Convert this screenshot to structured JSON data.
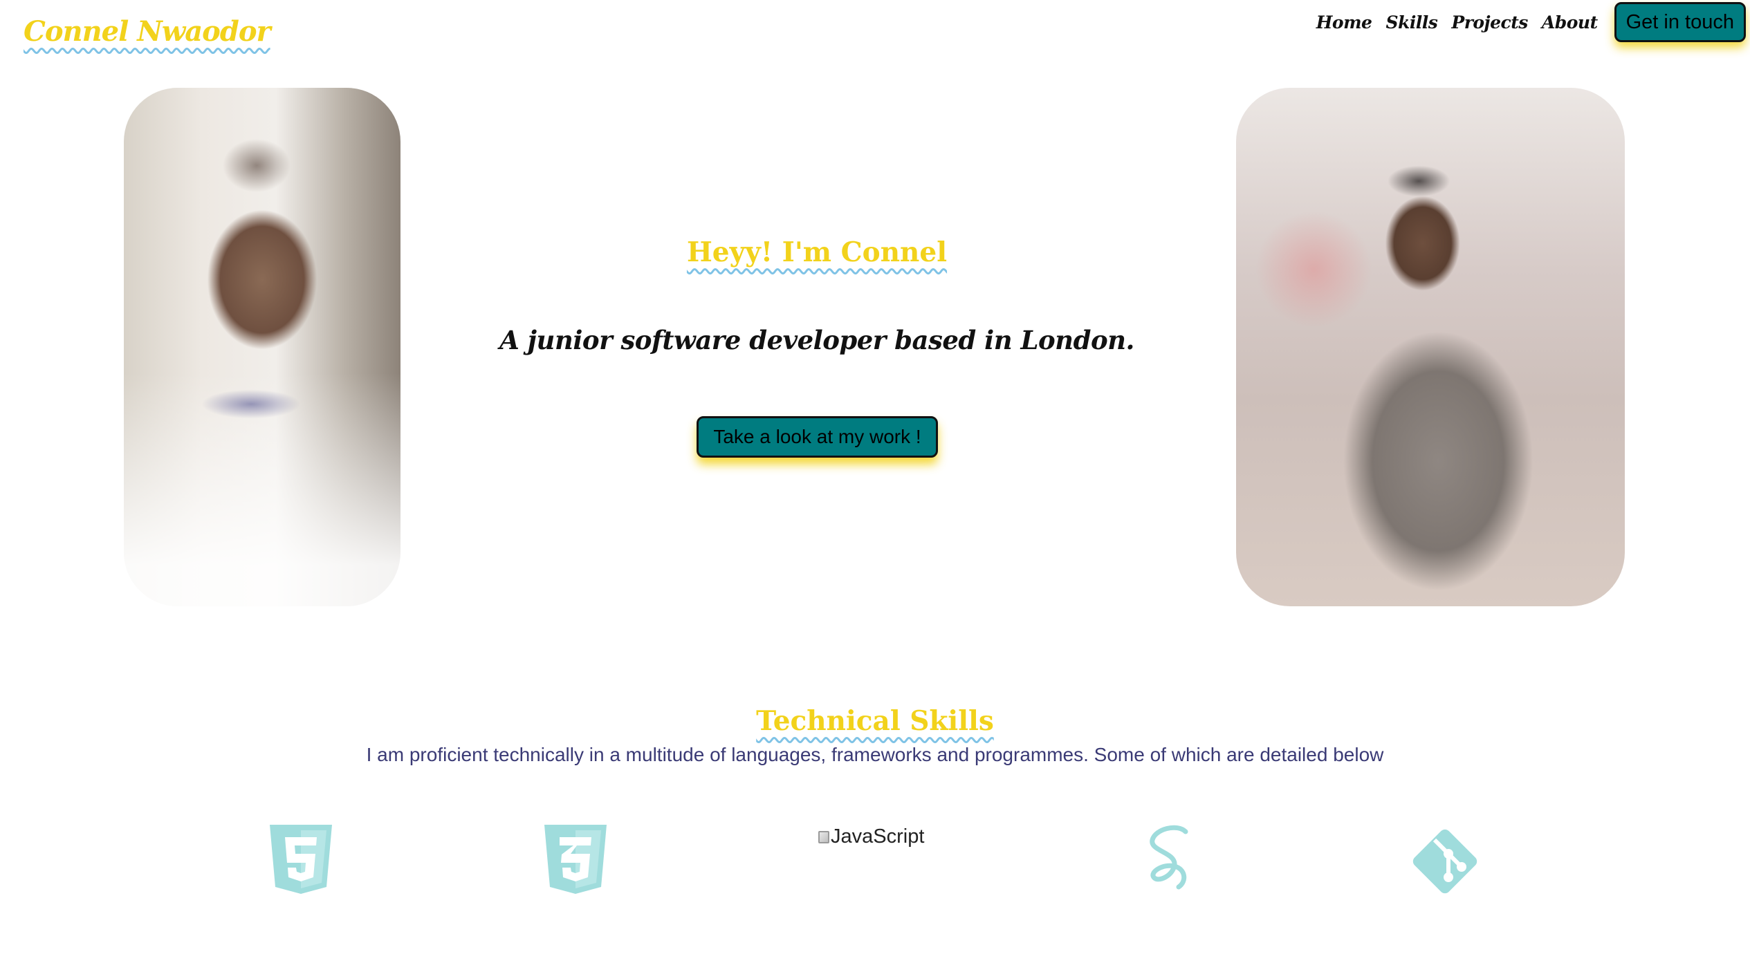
{
  "header": {
    "logo": "Connel Nwaodor",
    "nav": [
      {
        "label": "Home"
      },
      {
        "label": "Skills"
      },
      {
        "label": "Projects"
      },
      {
        "label": "About"
      }
    ],
    "contact_label": "Get in touch"
  },
  "hero": {
    "title": "Heyy! I'm Connel",
    "subtitle": "A junior software developer based in London.",
    "cta_label": "Take a look at my work !"
  },
  "skills": {
    "title": "Technical Skills",
    "description": "I am proficient technically in a multitude of languages, frameworks and programmes. Some of which are detailed below",
    "icons": [
      "html5-icon",
      "css3-icon",
      "javascript-icon",
      "sass-icon",
      "git-icon"
    ],
    "javascript_alt": "JavaScript"
  },
  "colors": {
    "accent_yellow": "#f2d21b",
    "button_teal": "#007c80",
    "icon_teal": "#9fdcdc",
    "wavy_underline": "#7fc3e6",
    "body_text_navy": "#3a3a75"
  }
}
